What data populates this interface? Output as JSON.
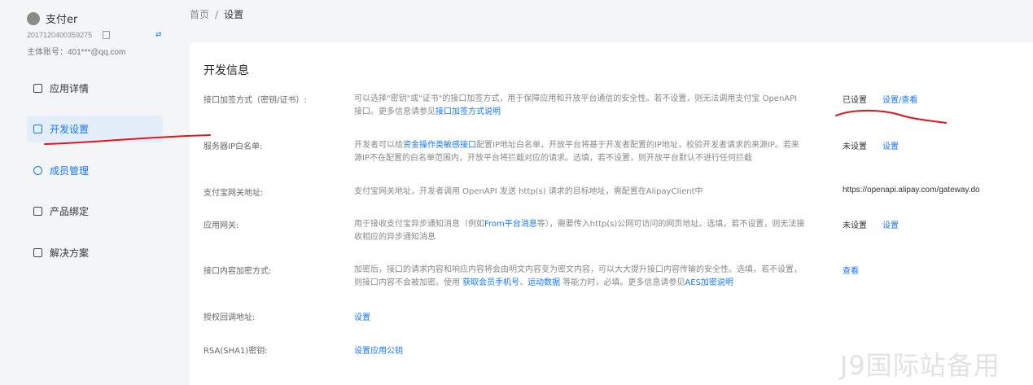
{
  "account": {
    "name": "支付er",
    "id": "2017120400359275",
    "main_account": "主体账号：401***@qq.com"
  },
  "nav": {
    "items": [
      {
        "label": "应用详情"
      },
      {
        "label": "开发设置"
      },
      {
        "label": "成员管理"
      },
      {
        "label": "产品绑定"
      },
      {
        "label": "解决方案"
      }
    ]
  },
  "breadcrumb": {
    "home": "首页",
    "separator": "/",
    "current": "设置"
  },
  "section_title": "开发信息",
  "rows": {
    "sign": {
      "label": "接口加签方式（密钥/证书）:",
      "desc_1": "可以选择\"密钥\"或\"证书\"的接口加签方式，用于保障应用和开放平台通信的安全性。若不设置，则无法调用支付宝 OpenAPI 接口。更多信息请参见",
      "desc_link": "接口加签方式说明",
      "status": "已设置",
      "action": "设置/查看"
    },
    "ip": {
      "label": "服务器IP白名单:",
      "desc_1": "开发者可以给",
      "desc_link": "资金操作类敏感接口",
      "desc_2": "配置IP地址白名单，开放平台将基于开发者配置的IP地址，校验开发者请求的来源IP。若来源IP不在配置的白名单范围内，开放平台将拦截对应的请求。选填，若不设置，则开放平台默认不进行任何拦截",
      "status": "未设置",
      "action": "设置"
    },
    "gateway": {
      "label": "支付宝网关地址:",
      "desc_1": "支付宝网关地址，开发者调用 OpenAPI 发送 http(s) 请求的目标地址，需配置在AlipayClient中",
      "value": "https://openapi.alipay.com/gateway.do"
    },
    "app_gateway": {
      "label": "应用网关:",
      "desc_1": "用于接收支付宝异步通知消息（例如",
      "desc_link": "From平台消息",
      "desc_2": "等），需要传入http(s)公网可访问的网页地址。选填，若不设置，则无法接收相应的异步通知消息",
      "status": "未设置",
      "action": "设置"
    },
    "encrypt": {
      "label": "接口内容加密方式:",
      "desc_1": "加密后，接口的请求内容和响应内容将会由明文内容变为密文内容，可以大大提升接口内容传输的安全性。选填，若不设置，则接口内容不会被加密。使用 ",
      "desc_link_1": "获取会员手机号",
      "desc_sep": "、",
      "desc_link_2": "运动数据",
      "desc_2": " 等能力时，必填。更多信息请参见",
      "desc_link_3": "AES加密说明",
      "action": "查看"
    },
    "callback": {
      "label": "授权回调地址:",
      "action": "设置"
    },
    "rsa": {
      "label": "RSA(SHA1)密钥:",
      "action": "设置应用公钥"
    }
  },
  "watermark": "J9国际站备用",
  "colors": {
    "accent": "#1677ff",
    "annotation": "#e0161b",
    "active_bg": "#e4eefb"
  }
}
